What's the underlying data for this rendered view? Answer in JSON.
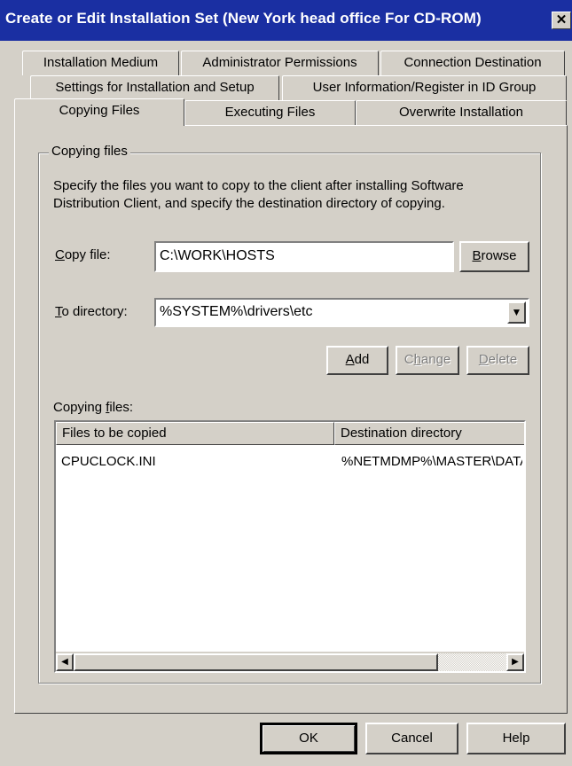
{
  "window": {
    "title": "Create or Edit Installation Set (New York head office For CD-ROM)",
    "close_glyph": "✕"
  },
  "tabs": {
    "row1": [
      "Installation Medium",
      "Administrator Permissions",
      "Connection Destination"
    ],
    "row2": [
      "Settings for Installation and Setup",
      "User Information/Register in ID Group"
    ],
    "row3": [
      "Copying Files",
      "Executing Files",
      "Overwrite Installation"
    ],
    "active": "Copying Files"
  },
  "group": {
    "legend": "Copying files",
    "description_line1": "Specify the files you want to copy to the client after installing Software",
    "description_line2": "Distribution Client, and specify the destination directory of copying."
  },
  "copy_file": {
    "label_mnemonic": "C",
    "label_rest": "opy file:",
    "value": "C:\\WORK\\HOSTS",
    "browse_mnemonic": "B",
    "browse_rest": "rowse"
  },
  "to_directory": {
    "label_mnemonic": "T",
    "label_rest": "o directory:",
    "value": "%SYSTEM%\\drivers\\etc",
    "dropdown_glyph": "▼"
  },
  "actions": {
    "add_mnemonic": "A",
    "add_rest": "dd",
    "change_pre": "C",
    "change_mnemonic": "h",
    "change_rest": "ange",
    "delete_mnemonic": "D",
    "delete_rest": "elete"
  },
  "copying_files": {
    "label_pre": "Copying ",
    "label_mnemonic": "f",
    "label_rest": "iles:",
    "columns": [
      "Files to be copied",
      "Destination directory"
    ],
    "rows": [
      {
        "file": "CPUCLOCK.INI",
        "destination": "%NETMDMP%\\MASTER\\DATA"
      }
    ],
    "scroll_left_glyph": "◀",
    "scroll_right_glyph": "▶"
  },
  "footer": {
    "ok": "OK",
    "cancel": "Cancel",
    "help": "Help"
  },
  "colors": {
    "titlebar": "#1a2fa2",
    "face": "#d4d0c8",
    "disabled_text": "#808080"
  }
}
